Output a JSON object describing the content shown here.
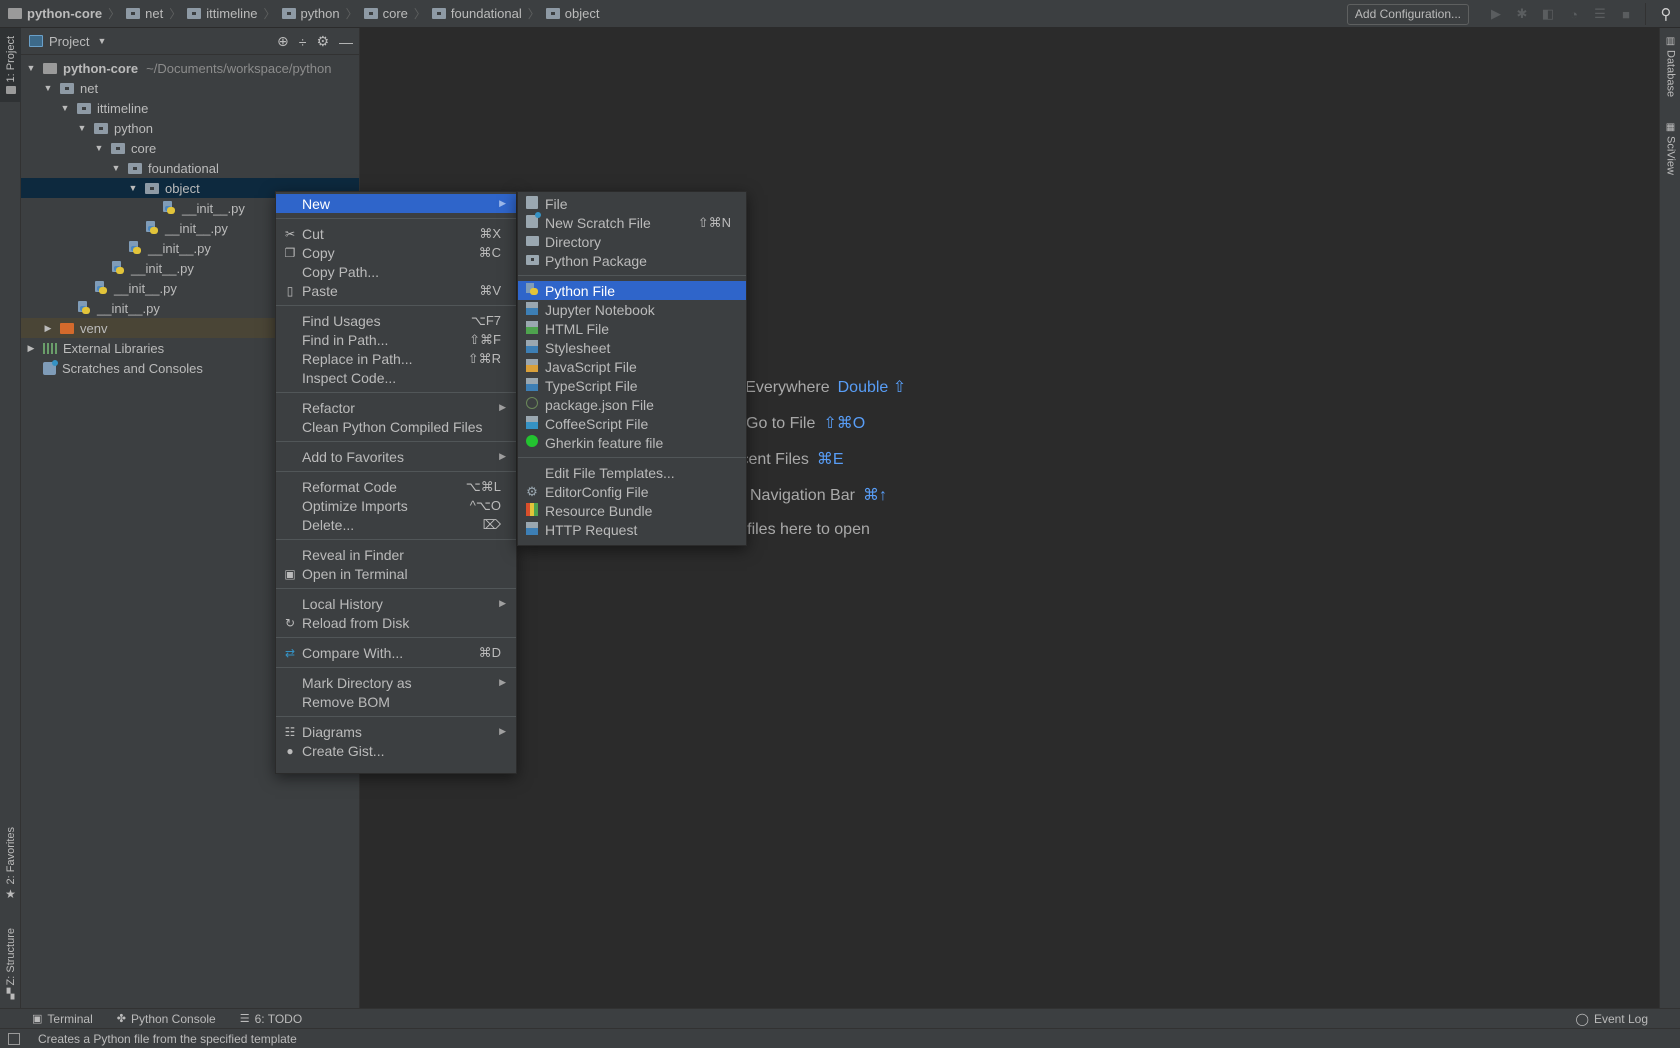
{
  "navbar": {
    "breadcrumbs": [
      "python-core",
      "net",
      "ittimeline",
      "python",
      "core",
      "foundational",
      "object"
    ],
    "add_configuration": "Add Configuration...",
    "toolbar_icons": [
      "run-icon",
      "debug-icon",
      "coverage-icon",
      "profile-icon",
      "concurrency-icon",
      "stop-icon"
    ]
  },
  "left_strip": {
    "project_tab": "1: Project",
    "favorites_tab": "2: Favorites",
    "structure_tab": "Z: Structure"
  },
  "right_strip": {
    "database_tab": "Database",
    "sciview_tab": "SciView"
  },
  "project_panel": {
    "title": "Project",
    "root": {
      "name": "python-core",
      "path": "~/Documents/workspace/python"
    },
    "tree": [
      {
        "label": "net",
        "depth": 1,
        "type": "folder",
        "expanded": true
      },
      {
        "label": "ittimeline",
        "depth": 2,
        "type": "folder",
        "expanded": true
      },
      {
        "label": "python",
        "depth": 3,
        "type": "folder",
        "expanded": true
      },
      {
        "label": "core",
        "depth": 4,
        "type": "folder",
        "expanded": true
      },
      {
        "label": "foundational",
        "depth": 5,
        "type": "folder",
        "expanded": true
      },
      {
        "label": "object",
        "depth": 6,
        "type": "folder",
        "expanded": true,
        "selected": true
      },
      {
        "label": "__init__.py",
        "depth": 7,
        "type": "py"
      },
      {
        "label": "__init__.py",
        "depth": 6,
        "type": "py"
      },
      {
        "label": "__init__.py",
        "depth": 5,
        "type": "py"
      },
      {
        "label": "__init__.py",
        "depth": 4,
        "type": "py"
      },
      {
        "label": "__init__.py",
        "depth": 3,
        "type": "py"
      },
      {
        "label": "__init__.py",
        "depth": 2,
        "type": "py"
      },
      {
        "label": "venv",
        "depth": 1,
        "type": "venv",
        "expanded": false
      }
    ],
    "external_libraries": "External Libraries",
    "scratches": "Scratches and Consoles"
  },
  "editor_hints": [
    {
      "text": "Search Everywhere",
      "key": "Double ⇧"
    },
    {
      "text": "Go to File",
      "key": "⇧⌘O"
    },
    {
      "text": "Recent Files",
      "key": "⌘E"
    },
    {
      "text": "Navigation Bar",
      "key": "⌘↑"
    },
    {
      "text": "Drop files here to open",
      "key": ""
    }
  ],
  "context_menu": {
    "items": [
      {
        "label": "New",
        "submenu": true,
        "selected": true
      },
      {
        "sep": true
      },
      {
        "label": "Cut",
        "shortcut": "⌘X",
        "icon": "scissors-icon"
      },
      {
        "label": "Copy",
        "shortcut": "⌘C",
        "icon": "copy-icon"
      },
      {
        "label": "Copy Path...",
        "shortcut": ""
      },
      {
        "label": "Paste",
        "shortcut": "⌘V",
        "icon": "paste-icon"
      },
      {
        "sep": true
      },
      {
        "label": "Find Usages",
        "shortcut": "⌥F7"
      },
      {
        "label": "Find in Path...",
        "shortcut": "⇧⌘F"
      },
      {
        "label": "Replace in Path...",
        "shortcut": "⇧⌘R"
      },
      {
        "label": "Inspect Code...",
        "shortcut": ""
      },
      {
        "sep": true
      },
      {
        "label": "Refactor",
        "submenu": true
      },
      {
        "label": "Clean Python Compiled Files"
      },
      {
        "sep": true
      },
      {
        "label": "Add to Favorites",
        "submenu": true
      },
      {
        "sep": true
      },
      {
        "label": "Reformat Code",
        "shortcut": "⌥⌘L"
      },
      {
        "label": "Optimize Imports",
        "shortcut": "^⌥O"
      },
      {
        "label": "Delete...",
        "shortcut": "⌦"
      },
      {
        "sep": true
      },
      {
        "label": "Reveal in Finder"
      },
      {
        "label": "Open in Terminal",
        "icon": "terminal-icon"
      },
      {
        "sep": true
      },
      {
        "label": "Local History",
        "submenu": true
      },
      {
        "label": "Reload from Disk",
        "icon": "reload-icon"
      },
      {
        "sep": true
      },
      {
        "label": "Compare With...",
        "shortcut": "⌘D",
        "icon": "compare-icon"
      },
      {
        "sep": true
      },
      {
        "label": "Mark Directory as",
        "submenu": true
      },
      {
        "label": "Remove BOM"
      },
      {
        "sep": true
      },
      {
        "label": "Diagrams",
        "submenu": true,
        "icon": "diagram-icon"
      },
      {
        "label": "Create Gist...",
        "icon": "github-icon"
      }
    ]
  },
  "new_submenu": {
    "items": [
      {
        "label": "File",
        "icon": "file"
      },
      {
        "label": "New Scratch File",
        "shortcut": "⇧⌘N",
        "icon": "scratch"
      },
      {
        "label": "Directory",
        "icon": "dir"
      },
      {
        "label": "Python Package",
        "icon": "pkg"
      },
      {
        "sep": true
      },
      {
        "label": "Python File",
        "icon": "pyf",
        "selected": true
      },
      {
        "label": "Jupyter Notebook",
        "icon": "tag",
        "color": "#3d7fb5"
      },
      {
        "label": "HTML File",
        "icon": "tag",
        "color": "#4ea34e"
      },
      {
        "label": "Stylesheet",
        "icon": "tag",
        "color": "#3d7fb5"
      },
      {
        "label": "JavaScript File",
        "icon": "tag",
        "color": "#d9a03a"
      },
      {
        "label": "TypeScript File",
        "icon": "tag",
        "color": "#3d7fb5"
      },
      {
        "label": "package.json File",
        "icon": "json"
      },
      {
        "label": "CoffeeScript File",
        "icon": "tag",
        "color": "#3592c4"
      },
      {
        "label": "Gherkin feature file",
        "icon": "cucumber"
      },
      {
        "sep": true
      },
      {
        "label": "Edit File Templates...",
        "icon": ""
      },
      {
        "label": "EditorConfig File",
        "icon": "gear"
      },
      {
        "label": "Resource Bundle",
        "icon": "bundle"
      },
      {
        "label": "HTTP Request",
        "icon": "tag",
        "color": "#3d7fb5"
      }
    ]
  },
  "bottom_tabs": {
    "terminal": "Terminal",
    "python_console": "Python Console",
    "todo": "6: TODO",
    "event_log": "Event Log"
  },
  "status_bar": {
    "message": "Creates a Python file from the specified template"
  },
  "colors": {
    "selection": "#2f65ca",
    "accent_key": "#589df6",
    "tree_selection": "#0d293e"
  }
}
